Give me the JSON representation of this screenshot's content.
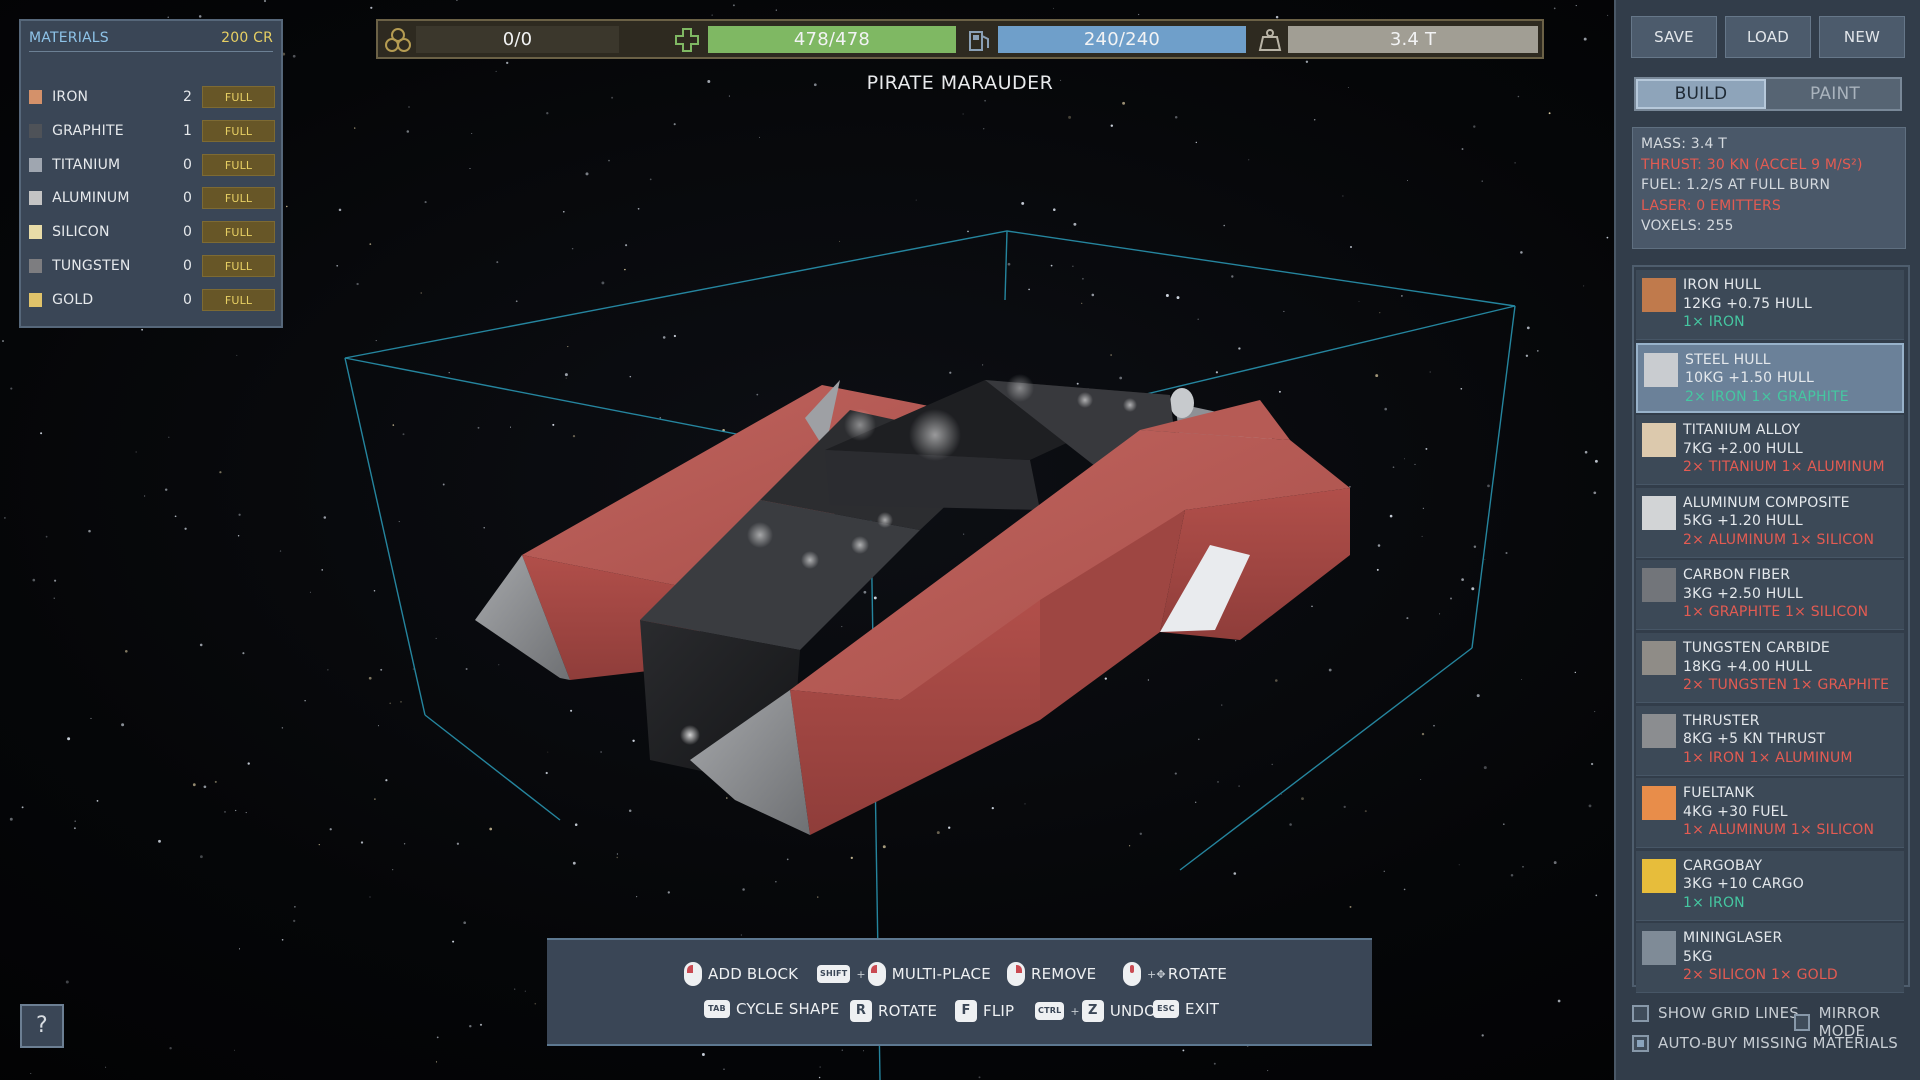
{
  "materials": {
    "title": "MATERIALS",
    "credits": "200 CR",
    "items": [
      {
        "name": "IRON",
        "count": "2",
        "action": "FULL",
        "color": "#d4916a"
      },
      {
        "name": "GRAPHITE",
        "count": "1",
        "action": "FULL",
        "color": "#4e5258"
      },
      {
        "name": "TITANIUM",
        "count": "0",
        "action": "FULL",
        "color": "#9fa6b0"
      },
      {
        "name": "ALUMINUM",
        "count": "0",
        "action": "FULL",
        "color": "#c4c4c4"
      },
      {
        "name": "SILICON",
        "count": "0",
        "action": "FULL",
        "color": "#e8dca8"
      },
      {
        "name": "TUNGSTEN",
        "count": "0",
        "action": "FULL",
        "color": "#7d7d80"
      },
      {
        "name": "GOLD",
        "count": "0",
        "action": "FULL",
        "color": "#e0c36a"
      }
    ]
  },
  "stats_bar": {
    "cargo": {
      "icon": "cargo-icon",
      "text": "0/0",
      "fill": 0,
      "color": "#3b372c"
    },
    "hull": {
      "icon": "health-cross-icon",
      "text": "478/478",
      "fill": 1,
      "color": "#7fb863"
    },
    "fuel": {
      "icon": "fuel-pump-icon",
      "text": "240/240",
      "fill": 1,
      "color": "#6f9fca"
    },
    "mass": {
      "icon": "weight-icon",
      "text": "3.4 T",
      "fill": 1,
      "color": "#a19e94"
    }
  },
  "ship_name": "PIRATE MARAUDER",
  "controls": {
    "row1": [
      {
        "label": "ADD BLOCK",
        "icon": "mouse-left-icon"
      },
      {
        "label": "MULTI-PLACE",
        "icon": "shift-mouse-left-icon",
        "key": "SHIFT"
      },
      {
        "label": "REMOVE",
        "icon": "mouse-right-icon"
      },
      {
        "label": "ROTATE",
        "icon": "mouse-drag-icon"
      }
    ],
    "row2": [
      {
        "label": "CYCLE SHAPE",
        "key": "TAB"
      },
      {
        "label": "ROTATE",
        "key": "R"
      },
      {
        "label": "FLIP",
        "key": "F"
      },
      {
        "label": "UNDO",
        "key": "Z",
        "modifier": "CTRL"
      },
      {
        "label": "EXIT",
        "key": "ESC"
      }
    ]
  },
  "help": "?",
  "sidebar": {
    "buttons": {
      "save": "SAVE",
      "load": "LOAD",
      "new": "NEW"
    },
    "tabs": {
      "build": "BUILD",
      "paint": "PAINT"
    },
    "stats": {
      "mass": "MASS:   3.4 T",
      "thrust": "THRUST: 30 KN  (ACCEL 9 M/S²)",
      "fuel": "FUEL:    1.2/S AT FULL BURN",
      "laser": "LASER:  0 EMITTERS",
      "voxels": "VOXELS: 255"
    },
    "blocks": [
      {
        "name": "IRON HULL",
        "stats": "12KG  +0.75 HULL",
        "cost": "1× IRON",
        "cost_color": "teal",
        "thumb": "#c07a4c"
      },
      {
        "name": "STEEL HULL",
        "stats": "10KG  +1.50 HULL",
        "cost": "2× IRON  1× GRAPHITE",
        "cost_color": "teal",
        "thumb": "#c9ccd0",
        "selected": true
      },
      {
        "name": "TITANIUM ALLOY",
        "stats": "7KG  +2.00 HULL",
        "cost": "2× TITANIUM  1× ALUMINUM",
        "cost_color": "red",
        "thumb": "#dcc9ad"
      },
      {
        "name": "ALUMINUM COMPOSITE",
        "stats": "5KG  +1.20 HULL",
        "cost": "2× ALUMINUM  1× SILICON",
        "cost_color": "red",
        "thumb": "#d2d4d6"
      },
      {
        "name": "CARBON FIBER",
        "stats": "3KG  +2.50 HULL",
        "cost": "1× GRAPHITE  1× SILICON",
        "cost_color": "red",
        "thumb": "#72757a"
      },
      {
        "name": "TUNGSTEN CARBIDE",
        "stats": "18KG  +4.00 HULL",
        "cost": "2× TUNGSTEN  1× GRAPHITE",
        "cost_color": "red",
        "thumb": "#8f8c87"
      },
      {
        "name": "THRUSTER",
        "stats": "8KG  +5 KN THRUST",
        "cost": "1× IRON  1× ALUMINUM",
        "cost_color": "red",
        "thumb": "#8b8d90"
      },
      {
        "name": "FUELTANK",
        "stats": "4KG  +30 FUEL",
        "cost": "1× ALUMINUM  1× SILICON",
        "cost_color": "red",
        "thumb": "#e88d4a"
      },
      {
        "name": "CARGOBAY",
        "stats": "3KG  +10 CARGO",
        "cost": "1× IRON",
        "cost_color": "teal",
        "thumb": "#e7bd3b"
      },
      {
        "name": "MININGLASER",
        "stats": "5KG",
        "cost": "2× SILICON  1× GOLD",
        "cost_color": "red",
        "thumb": "#7f8b97"
      }
    ],
    "options": {
      "grid_lines": {
        "label": "SHOW GRID LINES",
        "checked": false
      },
      "mirror": {
        "label": "MIRROR MODE",
        "checked": false
      },
      "auto_buy": {
        "label": "AUTO-BUY MISSING MATERIALS",
        "checked": true
      }
    }
  }
}
